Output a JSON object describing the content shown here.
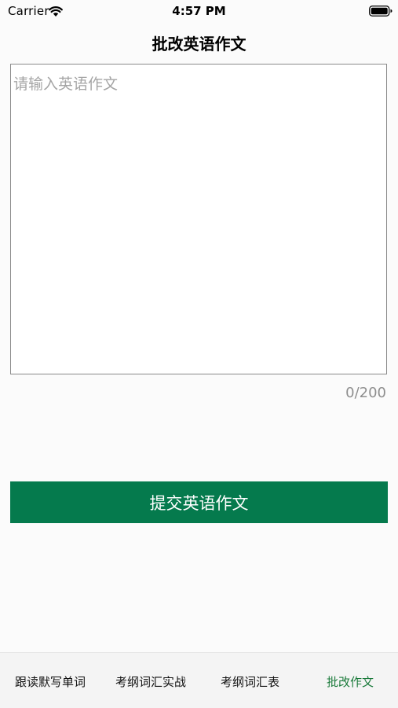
{
  "status_bar": {
    "carrier": "Carrier",
    "time": "4:57 PM"
  },
  "nav": {
    "title": "批改英语作文"
  },
  "essay": {
    "placeholder": "请输入英语作文",
    "counter": "0/200"
  },
  "submit": {
    "label": "提交英语作文",
    "color": "#057a4d"
  },
  "tabs": [
    {
      "label": "跟读默写单词",
      "active": false
    },
    {
      "label": "考纲词汇实战",
      "active": false
    },
    {
      "label": "考纲词汇表",
      "active": false
    },
    {
      "label": "批改作文",
      "active": true
    }
  ],
  "colors": {
    "active_tab": "#1a7a3a"
  }
}
